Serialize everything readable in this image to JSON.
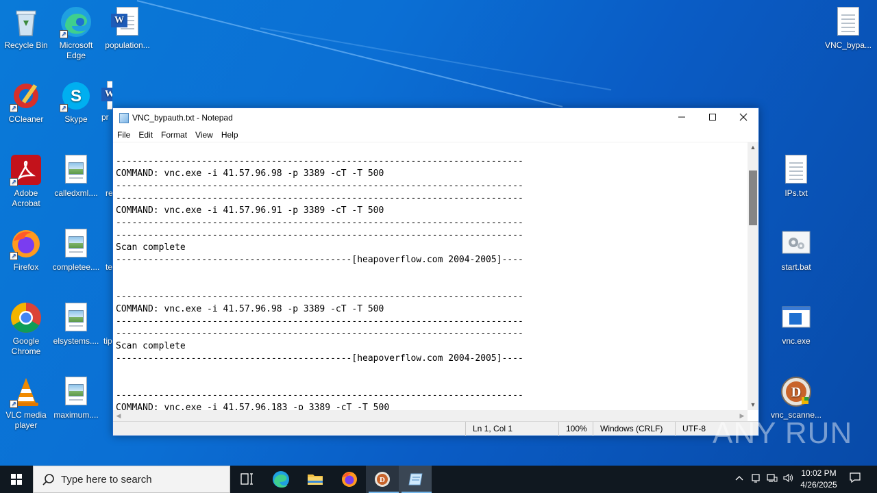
{
  "desktop": {
    "icons": [
      {
        "id": "recycle-bin",
        "label": "Recycle Bin"
      },
      {
        "id": "microsoft-edge",
        "label": "Microsoft Edge"
      },
      {
        "id": "population-doc",
        "label": "population..."
      },
      {
        "id": "ccleaner",
        "label": "CCleaner"
      },
      {
        "id": "skype",
        "label": "Skype"
      },
      {
        "id": "pr-doc",
        "label": "pr"
      },
      {
        "id": "adobe-acrobat",
        "label": "Adobe Acrobat"
      },
      {
        "id": "calledxml",
        "label": "calledxml...."
      },
      {
        "id": "re-partial",
        "label": "re"
      },
      {
        "id": "firefox",
        "label": "Firefox"
      },
      {
        "id": "completee",
        "label": "completee...."
      },
      {
        "id": "te-partial",
        "label": "te"
      },
      {
        "id": "google-chrome",
        "label": "Google Chrome"
      },
      {
        "id": "elsystems",
        "label": "elsystems...."
      },
      {
        "id": "tip-partial",
        "label": "tip"
      },
      {
        "id": "vlc",
        "label": "VLC media player"
      },
      {
        "id": "maximum",
        "label": "maximum...."
      },
      {
        "id": "vnc-bypa",
        "label": "VNC_bypa..."
      },
      {
        "id": "ips-txt",
        "label": "IPs.txt"
      },
      {
        "id": "start-bat",
        "label": "start.bat"
      },
      {
        "id": "vnc-exe",
        "label": "vnc.exe"
      },
      {
        "id": "vnc-scanner",
        "label": "vnc_scanne..."
      }
    ]
  },
  "notepad": {
    "title": "VNC_bypauth.txt - Notepad",
    "menu": [
      "File",
      "Edit",
      "Format",
      "View",
      "Help"
    ],
    "content": "----------------------------------------------------------------------------\nCOMMAND: vnc.exe -i 41.57.96.98 -p 3389 -cT -T 500\n----------------------------------------------------------------------------\n----------------------------------------------------------------------------\nCOMMAND: vnc.exe -i 41.57.96.91 -p 3389 -cT -T 500\n----------------------------------------------------------------------------\n----------------------------------------------------------------------------\nScan complete\n--------------------------------------------[heapoverflow.com 2004-2005]----\n\n\n----------------------------------------------------------------------------\nCOMMAND: vnc.exe -i 41.57.96.98 -p 3389 -cT -T 500\n----------------------------------------------------------------------------\n----------------------------------------------------------------------------\nScan complete\n--------------------------------------------[heapoverflow.com 2004-2005]----\n\n\n----------------------------------------------------------------------------\nCOMMAND: vnc.exe -i 41.57.96.183 -p 3389 -cT -T 500",
    "status": {
      "position": "Ln 1, Col 1",
      "zoom": "100%",
      "line_ending": "Windows (CRLF)",
      "encoding": "UTF-8"
    }
  },
  "watermark": "ANY RUN",
  "taskbar": {
    "search_placeholder": "Type here to search",
    "clock_time": "10:02 PM",
    "clock_date": "4/26/2025"
  },
  "colors": {
    "desktop_blue": "#0a6fd4",
    "taskbar": "#101820",
    "window_border": "#1e66c8"
  }
}
